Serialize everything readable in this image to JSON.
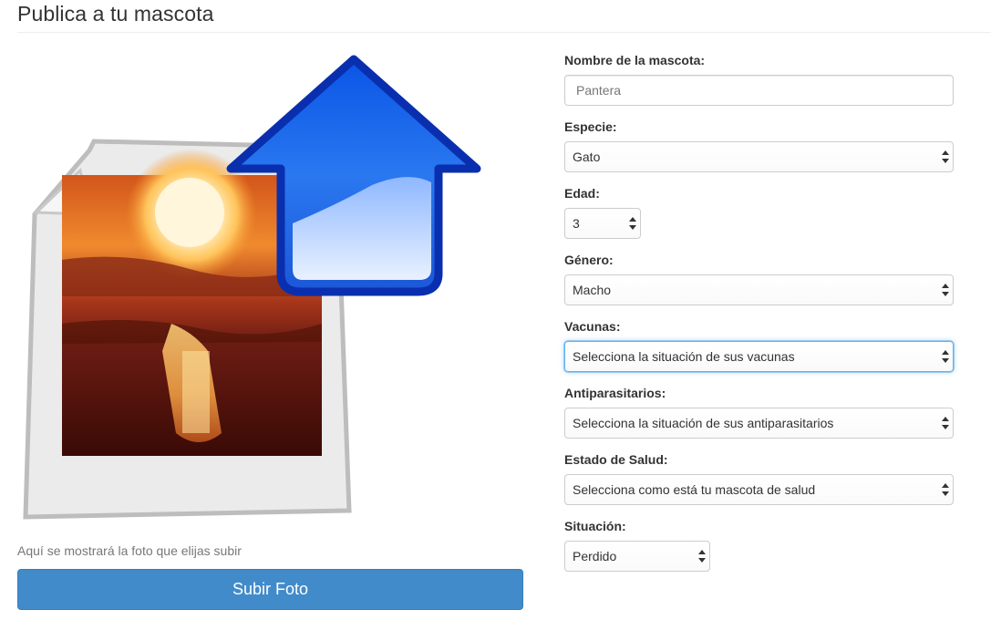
{
  "page": {
    "title": "Publica a tu mascota"
  },
  "preview": {
    "caption": "Aquí se mostrará la foto que elijas subir",
    "upload_button_label": "Subir Foto"
  },
  "form": {
    "name": {
      "label": "Nombre de la mascota:",
      "placeholder": "Pantera",
      "value": ""
    },
    "species": {
      "label": "Especie:",
      "selected": "Gato"
    },
    "age": {
      "label": "Edad:",
      "selected": "3"
    },
    "gender": {
      "label": "Género:",
      "selected": "Macho"
    },
    "vaccines": {
      "label": "Vacunas:",
      "selected": "Selecciona la situación de sus vacunas"
    },
    "antiparasitic": {
      "label": "Antiparasitarios:",
      "selected": "Selecciona la situación de sus antiparasitarios"
    },
    "health": {
      "label": "Estado de Salud:",
      "selected": "Selecciona como está tu mascota de salud"
    },
    "situation": {
      "label": "Situación:",
      "selected": "Perdido"
    }
  },
  "colors": {
    "primary_button": "#428bca",
    "focus_border": "#66afe9",
    "upload_arrow": "#1f5fd6"
  },
  "icons": {
    "illustration": "image-upload-icon",
    "select_arrows": "updown-arrows-icon"
  }
}
